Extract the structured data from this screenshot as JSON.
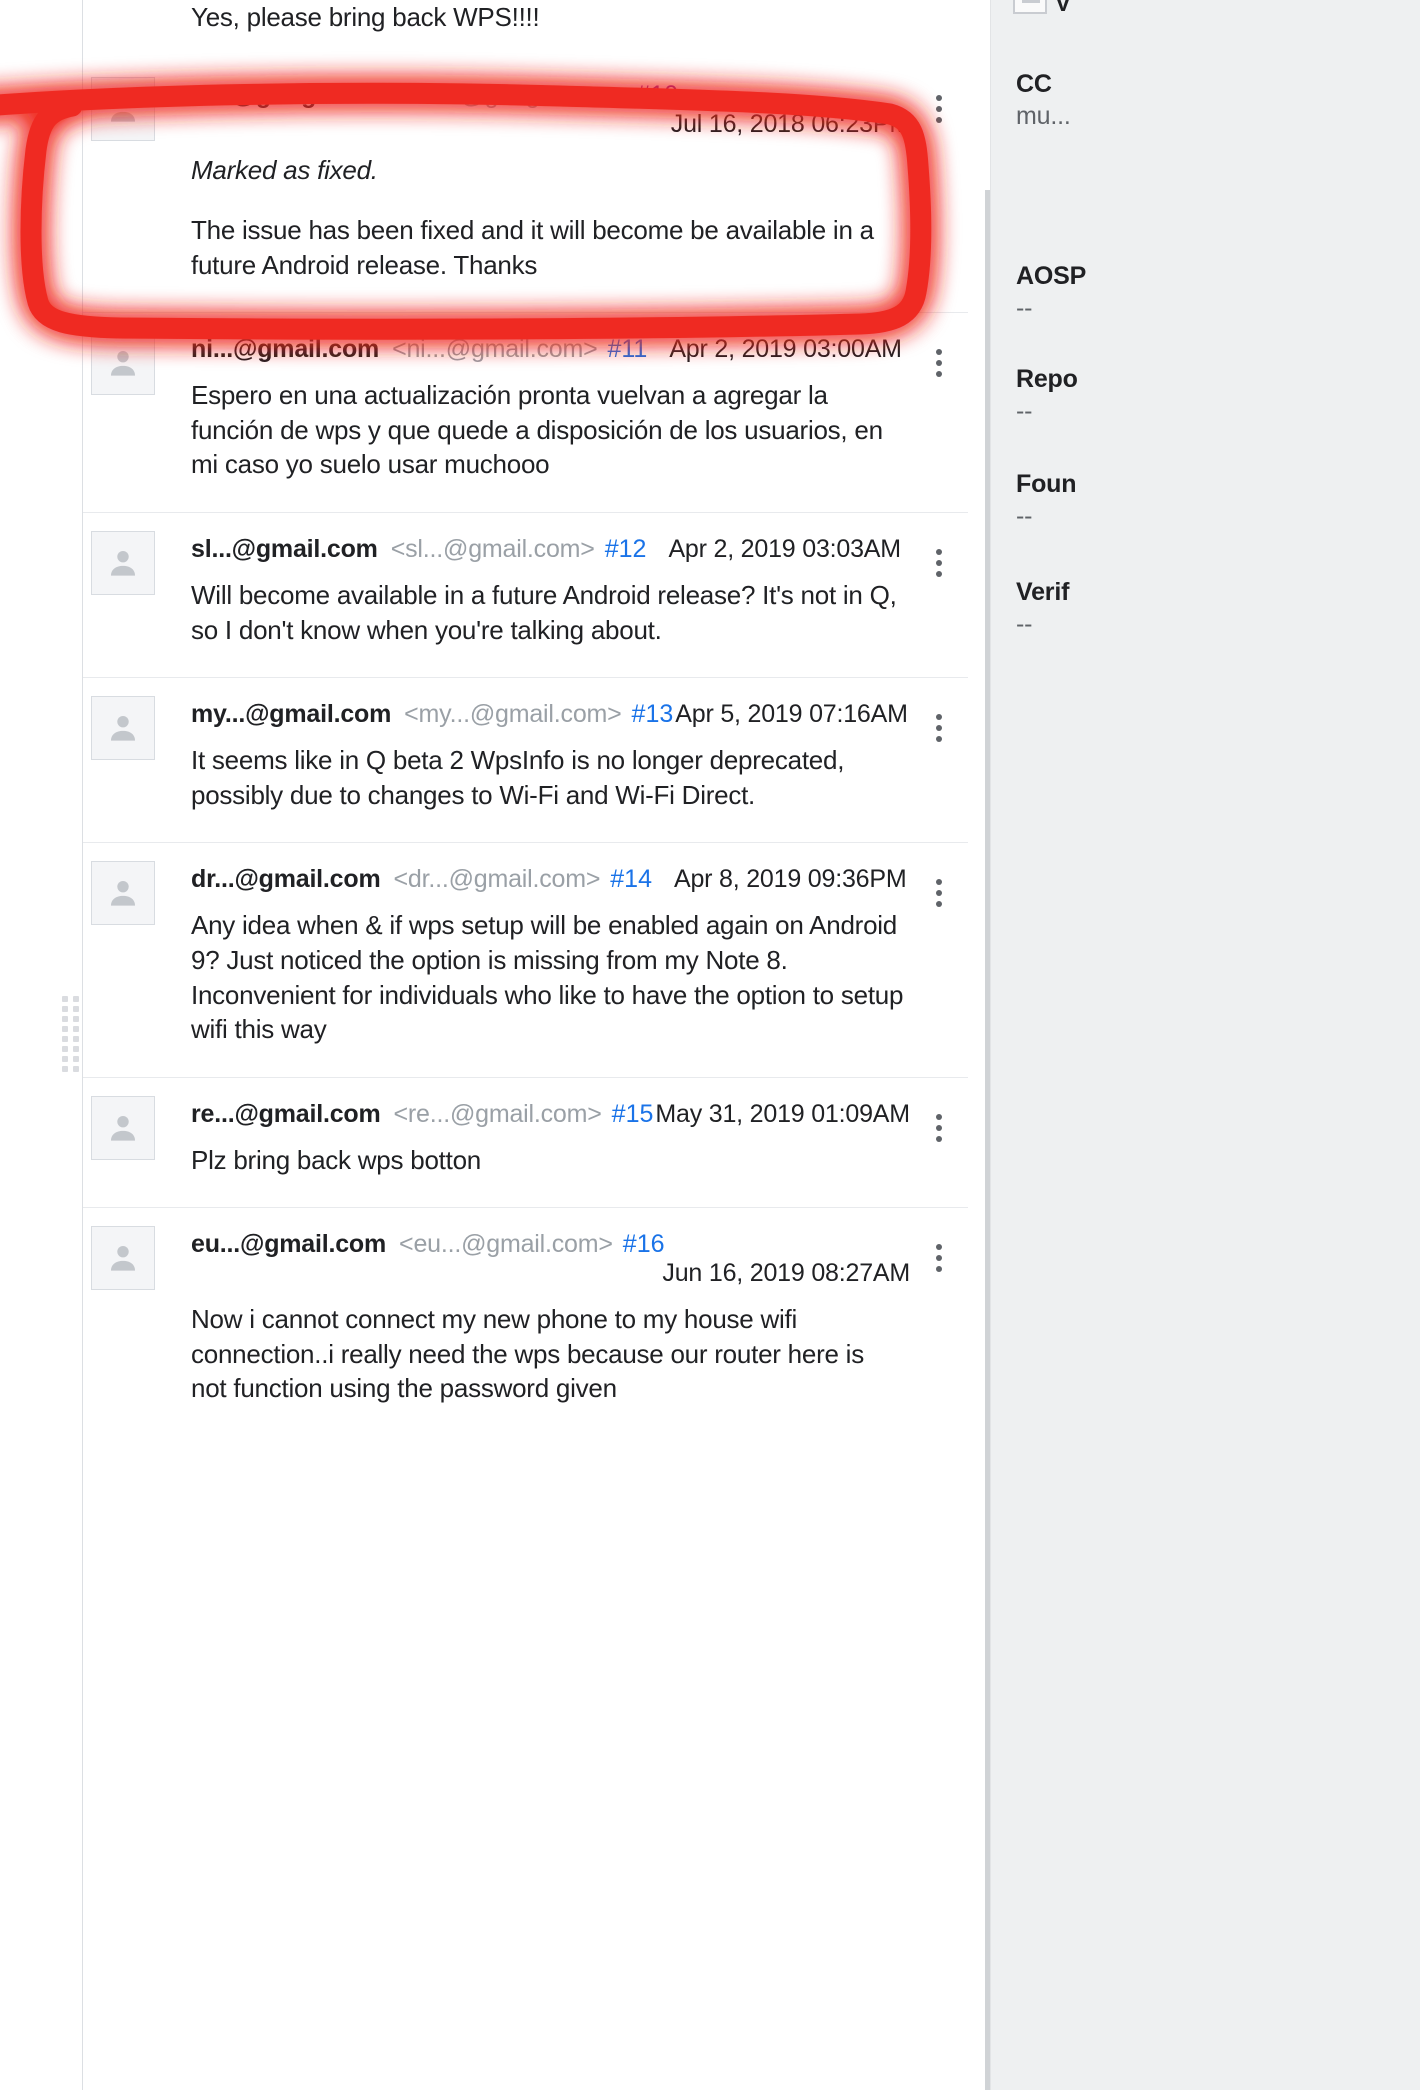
{
  "top_fragment": {
    "text": "Yes, please bring back WPS!!!!"
  },
  "comments": [
    {
      "author": "vi...@google.com",
      "email": "<vi...@google.com>",
      "number": "#10",
      "number_state": "visited",
      "date": "Jul 16, 2018 06:23PM",
      "date_layout": "block",
      "body": [
        {
          "text": "Marked as fixed.",
          "italic": true
        },
        {
          "text": "The issue has been fixed and it will become be available in a future Android release. Thanks",
          "italic": false
        }
      ]
    },
    {
      "author": "ni...@gmail.com",
      "email": "<ni...@gmail.com>",
      "number": "#11",
      "number_state": "link",
      "date": "Apr 2, 2019 03:00AM",
      "date_layout": "inline",
      "body": [
        {
          "text": "Espero en una actualización pronta vuelvan a agregar la función de wps y que quede a disposición de los usuarios, en mi caso yo suelo usar muchooo",
          "italic": false
        }
      ]
    },
    {
      "author": "sl...@gmail.com",
      "email": "<sl...@gmail.com>",
      "number": "#12",
      "number_state": "link",
      "date": "Apr 2, 2019 03:03AM",
      "date_layout": "inline",
      "body": [
        {
          "text": "Will become available in a future Android release? It's not in Q, so I don't know when you're talking about.",
          "italic": false
        }
      ]
    },
    {
      "author": "my...@gmail.com",
      "email": "<my...@gmail.com>",
      "number": "#13",
      "number_state": "link",
      "date": "Apr 5, 2019 07:16AM",
      "date_layout": "tight",
      "body": [
        {
          "text": "It seems like in Q beta 2 WpsInfo is no longer deprecated, possibly due to changes to Wi-Fi and Wi-Fi Direct.",
          "italic": false
        }
      ]
    },
    {
      "author": "dr...@gmail.com",
      "email": "<dr...@gmail.com>",
      "number": "#14",
      "number_state": "link",
      "date": "Apr 8, 2019 09:36PM",
      "date_layout": "inline",
      "body": [
        {
          "text": "Any idea when & if wps setup will be enabled again on Android 9? Just noticed the option is missing from my Note 8. Inconvenient for individuals who like to have the option to setup wifi this way",
          "italic": false
        }
      ]
    },
    {
      "author": "re...@gmail.com",
      "email": "<re...@gmail.com>",
      "number": "#15",
      "number_state": "link",
      "date": "May 31, 2019 01:09AM",
      "date_layout": "tight",
      "body": [
        {
          "text": "Plz bring back wps botton",
          "italic": false
        }
      ]
    },
    {
      "author": "eu...@gmail.com",
      "email": "<eu...@gmail.com>",
      "number": "#16",
      "number_state": "link",
      "date": "Jun 16, 2019 08:27AM",
      "date_layout": "block",
      "body": [
        {
          "text": "Now i cannot connect my new phone to my house wifi connection..i really need the wps because our router here is not function using the password given",
          "italic": false
        }
      ]
    }
  ],
  "meta_panel": {
    "top_fragment_label": "V",
    "fields": [
      {
        "label": "CC",
        "value": "mu..."
      },
      {
        "label": "AOSP",
        "value": "--"
      },
      {
        "label": "Repo",
        "value": "--"
      },
      {
        "label": "Foun",
        "value": "--"
      },
      {
        "label": "Verif",
        "value": "--"
      }
    ]
  },
  "annotation": {
    "color": "#ef2a23",
    "shape": "hand-drawn-rounded-rectangle-highlight"
  },
  "icons": {
    "avatar": "person-icon",
    "kebab": "more-vert-icon",
    "grip": "drag-handle-icon"
  }
}
